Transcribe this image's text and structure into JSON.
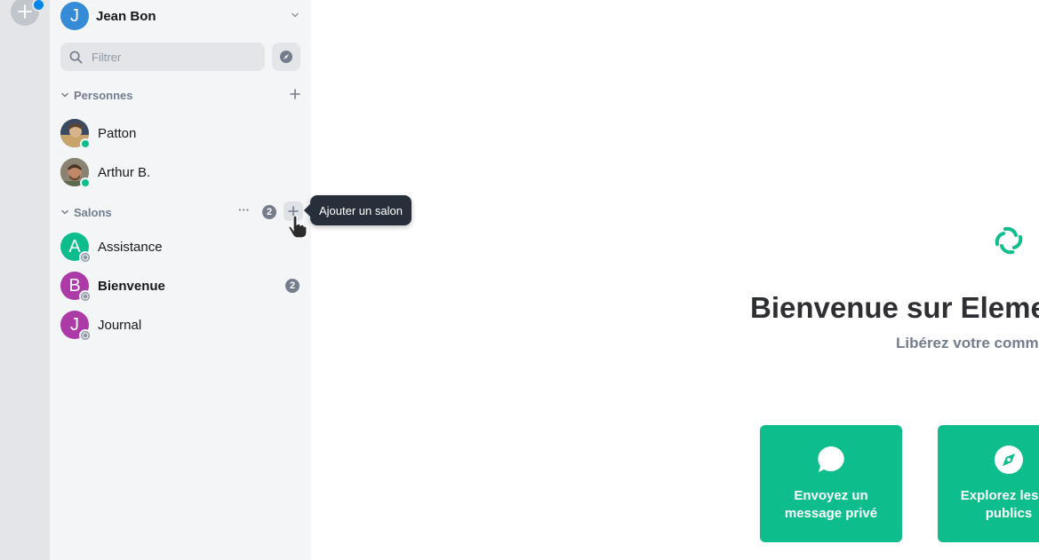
{
  "spacebar": {
    "add_space_icon": "plus-icon",
    "has_notification": true
  },
  "user": {
    "avatar_letter": "J",
    "name": "Jean Bon",
    "avatar_color": "#368bd6"
  },
  "filter": {
    "placeholder": "Filtrer",
    "icon": "search-icon"
  },
  "explore": {
    "icon": "compass-icon"
  },
  "people": {
    "section_label": "Personnes",
    "items": [
      {
        "name": "Patton",
        "presence": "online"
      },
      {
        "name": "Arthur B.",
        "presence": "online"
      }
    ]
  },
  "rooms": {
    "section_label": "Salons",
    "options_label": "···",
    "badge_count": "2",
    "items": [
      {
        "letter": "A",
        "name": "Assistance",
        "color": "#0dbd8b",
        "unread": ""
      },
      {
        "letter": "B",
        "name": "Bienvenue",
        "color": "#ac3ba8",
        "unread": "2",
        "bold": true
      },
      {
        "letter": "J",
        "name": "Journal",
        "color": "#ac3ba8",
        "unread": ""
      }
    ]
  },
  "tooltip": {
    "text": "Ajouter un salon"
  },
  "main": {
    "title": "Bienvenue sur Elemen",
    "subtitle": "Libérez votre comm",
    "cards": [
      {
        "label": "Envoyez un\nmessage privé",
        "icon": "chat-bubble-icon"
      },
      {
        "label": "Explorez les sa\npublics",
        "icon": "compass-icon"
      }
    ]
  },
  "colors": {
    "accent": "#0dbd8b",
    "sidebar_bg": "#f4f5f7",
    "spacebar_bg": "#e3e5e8"
  }
}
